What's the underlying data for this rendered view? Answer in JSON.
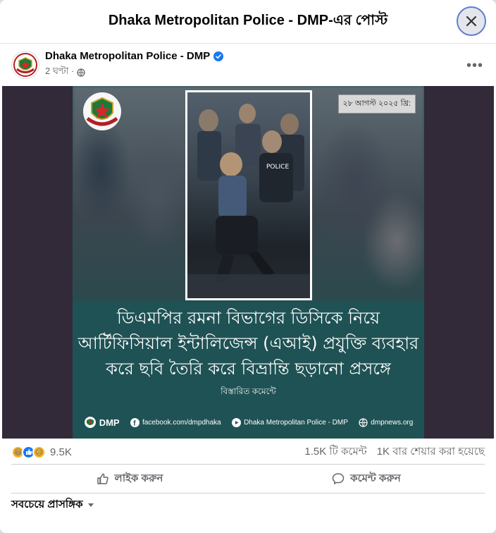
{
  "dialog": {
    "title": "Dhaka Metropolitan Police - DMP-এর পোস্ট",
    "close_icon": "close-icon"
  },
  "post": {
    "page_name": "Dhaka Metropolitan Police - DMP",
    "verified_icon": "verified-badge-icon",
    "time": "2 ঘণ্টা ·",
    "privacy_icon": "globe-icon",
    "more_icon": "more-options-icon"
  },
  "poster": {
    "date_badge": "২৮ আগস্ট ২০২৫ খ্রি:",
    "headline_lines": [
      "ডিএমপির রমনা বিভাগের ডিসিকে নিয়ে",
      "আর্টিফিসিয়াল ইন্টালিজেন্স (এআই) প্রযুক্তি ব্যবহার",
      "করে ছবি তৈরি করে বিভ্রান্তি ছড়ানো প্রসঙ্গে"
    ],
    "details": "বিস্তারিত কমেন্টে",
    "footer": {
      "dmp": "DMP",
      "facebook": "facebook.com/dmpdhaka",
      "youtube": "Dhaka Metropolitan Police - DMP",
      "web": "dmpnews.org"
    }
  },
  "stats": {
    "reactions_count": "9.5K",
    "comments": "1.5K টি কমেন্ট",
    "shares": "1K বার শেয়ার করা হয়েছে",
    "reaction_icons": [
      "haha-icon",
      "like-icon",
      "sad-icon"
    ]
  },
  "actions": {
    "like": "লাইক করুন",
    "comment": "কমেন্ট করুন"
  },
  "sort": {
    "label": "সবচেয়ে প্রাসঙ্গিক"
  },
  "colors": {
    "poster_bg": "#1f5254",
    "media_bg": "#322a39",
    "verified": "#1877f2",
    "like_blue": "#1877f2",
    "haha_yellow": "#f7b125"
  }
}
